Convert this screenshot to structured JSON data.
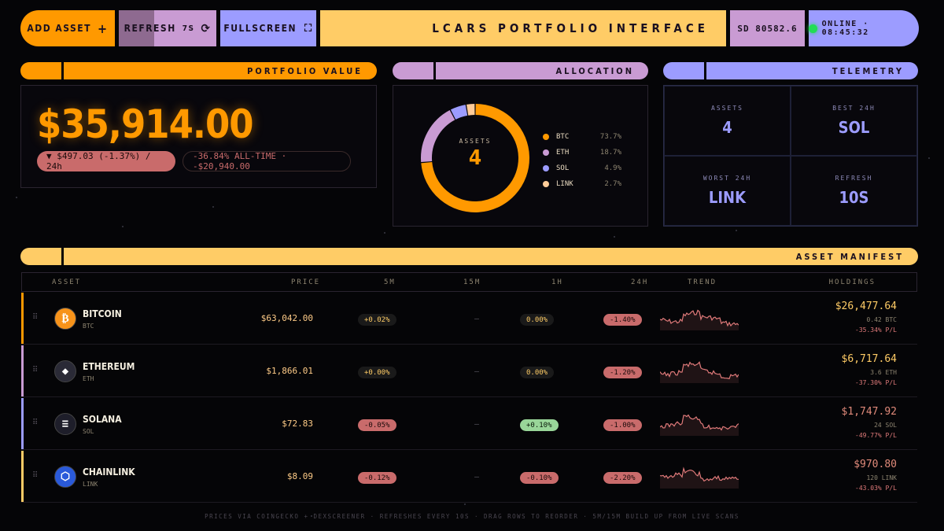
{
  "toolbar": {
    "add_label": "ADD ASSET",
    "add_icon": "+",
    "refresh_label": "REFRESH",
    "refresh_count": "7S",
    "refresh_progress": 0.36,
    "refresh_icon": "⟳",
    "fullscreen_label": "FULLSCREEN",
    "fullscreen_icon": "⛶",
    "title": "LCARS PORTFOLIO INTERFACE",
    "stardate": "SD 80582.6",
    "status": "ONLINE · 08:45:32"
  },
  "portfolio": {
    "header": "PORTFOLIO VALUE",
    "value": "$35,914.00",
    "change_24h": "▼ $497.03 (-1.37%) / 24h",
    "all_time": "-36.84% ALL-TIME · -$20,940.00"
  },
  "allocation": {
    "header": "ALLOCATION",
    "center_label": "ASSETS",
    "center_value": "4",
    "items": [
      {
        "name": "BTC",
        "pct": "73.7%",
        "value": 73.7,
        "color": "#ff9900"
      },
      {
        "name": "ETH",
        "pct": "18.7%",
        "value": 18.7,
        "color": "#c99bd3"
      },
      {
        "name": "SOL",
        "pct": "4.9%",
        "value": 4.9,
        "color": "#9c9cff"
      },
      {
        "name": "LINK",
        "pct": "2.7%",
        "value": 2.7,
        "color": "#ffcc99"
      }
    ]
  },
  "telemetry": {
    "header": "TELEMETRY",
    "cells": [
      {
        "label": "ASSETS",
        "value": "4"
      },
      {
        "label": "BEST 24H",
        "value": "SOL"
      },
      {
        "label": "WORST 24H",
        "value": "LINK"
      },
      {
        "label": "REFRESH",
        "value": "10S"
      }
    ]
  },
  "manifest": {
    "header": "ASSET MANIFEST",
    "columns": {
      "asset": "ASSET",
      "price": "PRICE",
      "m5": "5M",
      "m15": "15M",
      "h1": "1H",
      "h24": "24H",
      "trend": "TREND",
      "holdings": "HOLDINGS"
    },
    "rows": [
      {
        "name": "BITCOIN",
        "symbol": "BTC",
        "icon": "bitcoin-icon",
        "glyph": "₿",
        "coin_color": "#f7931a",
        "bar_color": "#ff9900",
        "price": "$63,042.00",
        "m5": "+0.02%",
        "m5_kind": "pos",
        "m15": "—",
        "h1": "0.00%",
        "h1_kind": "zero",
        "h24": "-1.40%",
        "h24_kind": "neg",
        "holding_value": "$26,477.64",
        "holding_qty": "0.42 BTC",
        "pl": "-35.34% P/L",
        "value_color": "#ffcc66"
      },
      {
        "name": "ETHEREUM",
        "symbol": "ETH",
        "icon": "ethereum-icon",
        "glyph": "◆",
        "coin_color": "#2a2a36",
        "bar_color": "#c99bd3",
        "price": "$1,866.01",
        "m5": "+0.00%",
        "m5_kind": "pos",
        "m15": "—",
        "h1": "0.00%",
        "h1_kind": "zero",
        "h24": "-1.20%",
        "h24_kind": "neg",
        "holding_value": "$6,717.64",
        "holding_qty": "3.6 ETH",
        "pl": "-37.30% P/L",
        "value_color": "#ffcc66"
      },
      {
        "name": "SOLANA",
        "symbol": "SOL",
        "icon": "solana-icon",
        "glyph": "≡",
        "coin_color": "#1e1e2a",
        "bar_color": "#9c9cff",
        "price": "$72.83",
        "m5": "-0.05%",
        "m5_kind": "neg",
        "m15": "—",
        "h1": "+0.10%",
        "h1_kind": "green",
        "h24": "-1.00%",
        "h24_kind": "neg",
        "holding_value": "$1,747.92",
        "holding_qty": "24 SOL",
        "pl": "-49.77% P/L",
        "value_color": "#e08a7a"
      },
      {
        "name": "CHAINLINK",
        "symbol": "LINK",
        "icon": "chainlink-icon",
        "glyph": "⬡",
        "coin_color": "#2a5ada",
        "bar_color": "#ffcc66",
        "price": "$8.09",
        "m5": "-0.12%",
        "m5_kind": "neg",
        "m15": "—",
        "h1": "-0.10%",
        "h1_kind": "neg",
        "h24": "-2.20%",
        "h24_kind": "neg",
        "holding_value": "$970.80",
        "holding_qty": "120 LINK",
        "pl": "-43.03% P/L",
        "value_color": "#e08a7a"
      }
    ]
  },
  "footer": "PRICES VIA COINGECKO + DEXSCREENER · REFRESHES EVERY 10S · DRAG ROWS TO REORDER · 5M/15M BUILD UP FROM LIVE SCANS"
}
